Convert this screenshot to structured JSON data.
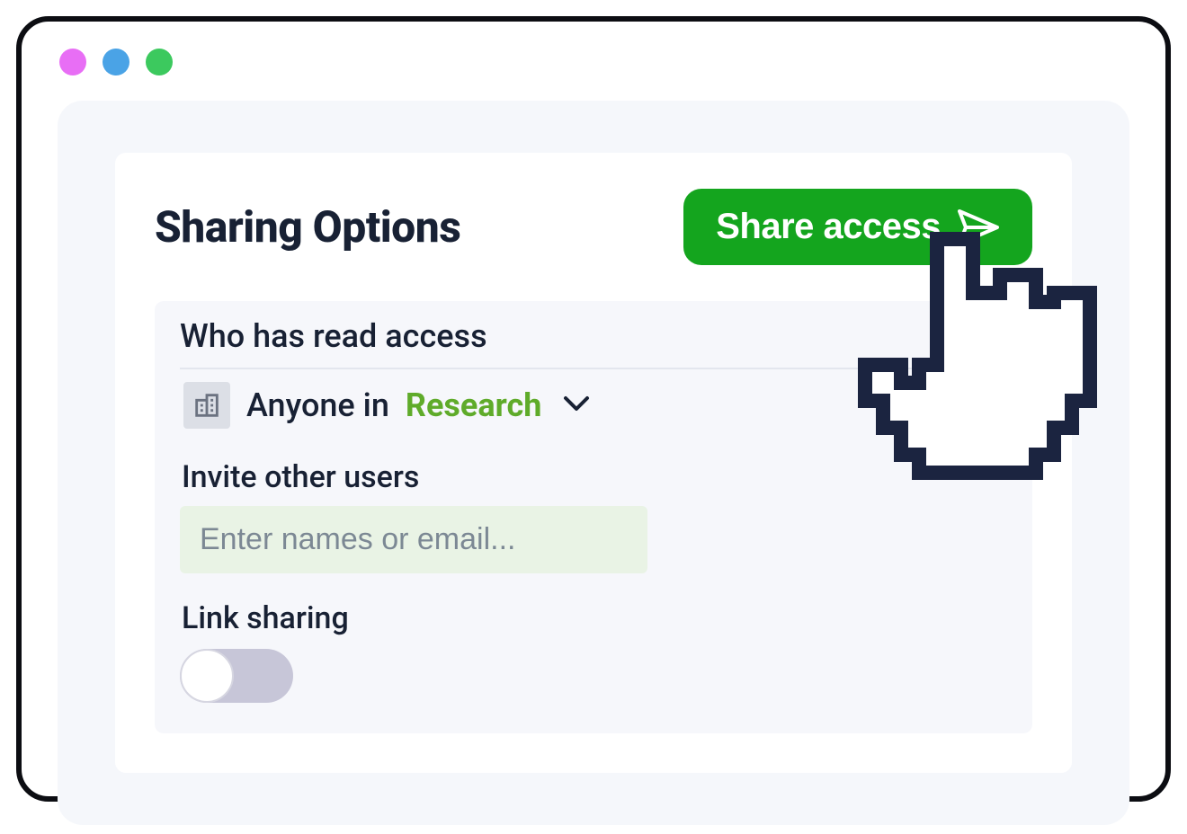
{
  "header": {
    "title": "Sharing Options",
    "share_button_label": "Share access"
  },
  "access": {
    "section_title": "Who has read access",
    "prefix": "Anyone in",
    "scope": "Research"
  },
  "invite": {
    "label": "Invite other users",
    "placeholder": "Enter names or email..."
  },
  "link_sharing": {
    "label": "Link sharing",
    "enabled": false
  },
  "colors": {
    "accent_green": "#14a51e",
    "scope_green": "#5fab2a",
    "text_dark": "#182134"
  }
}
